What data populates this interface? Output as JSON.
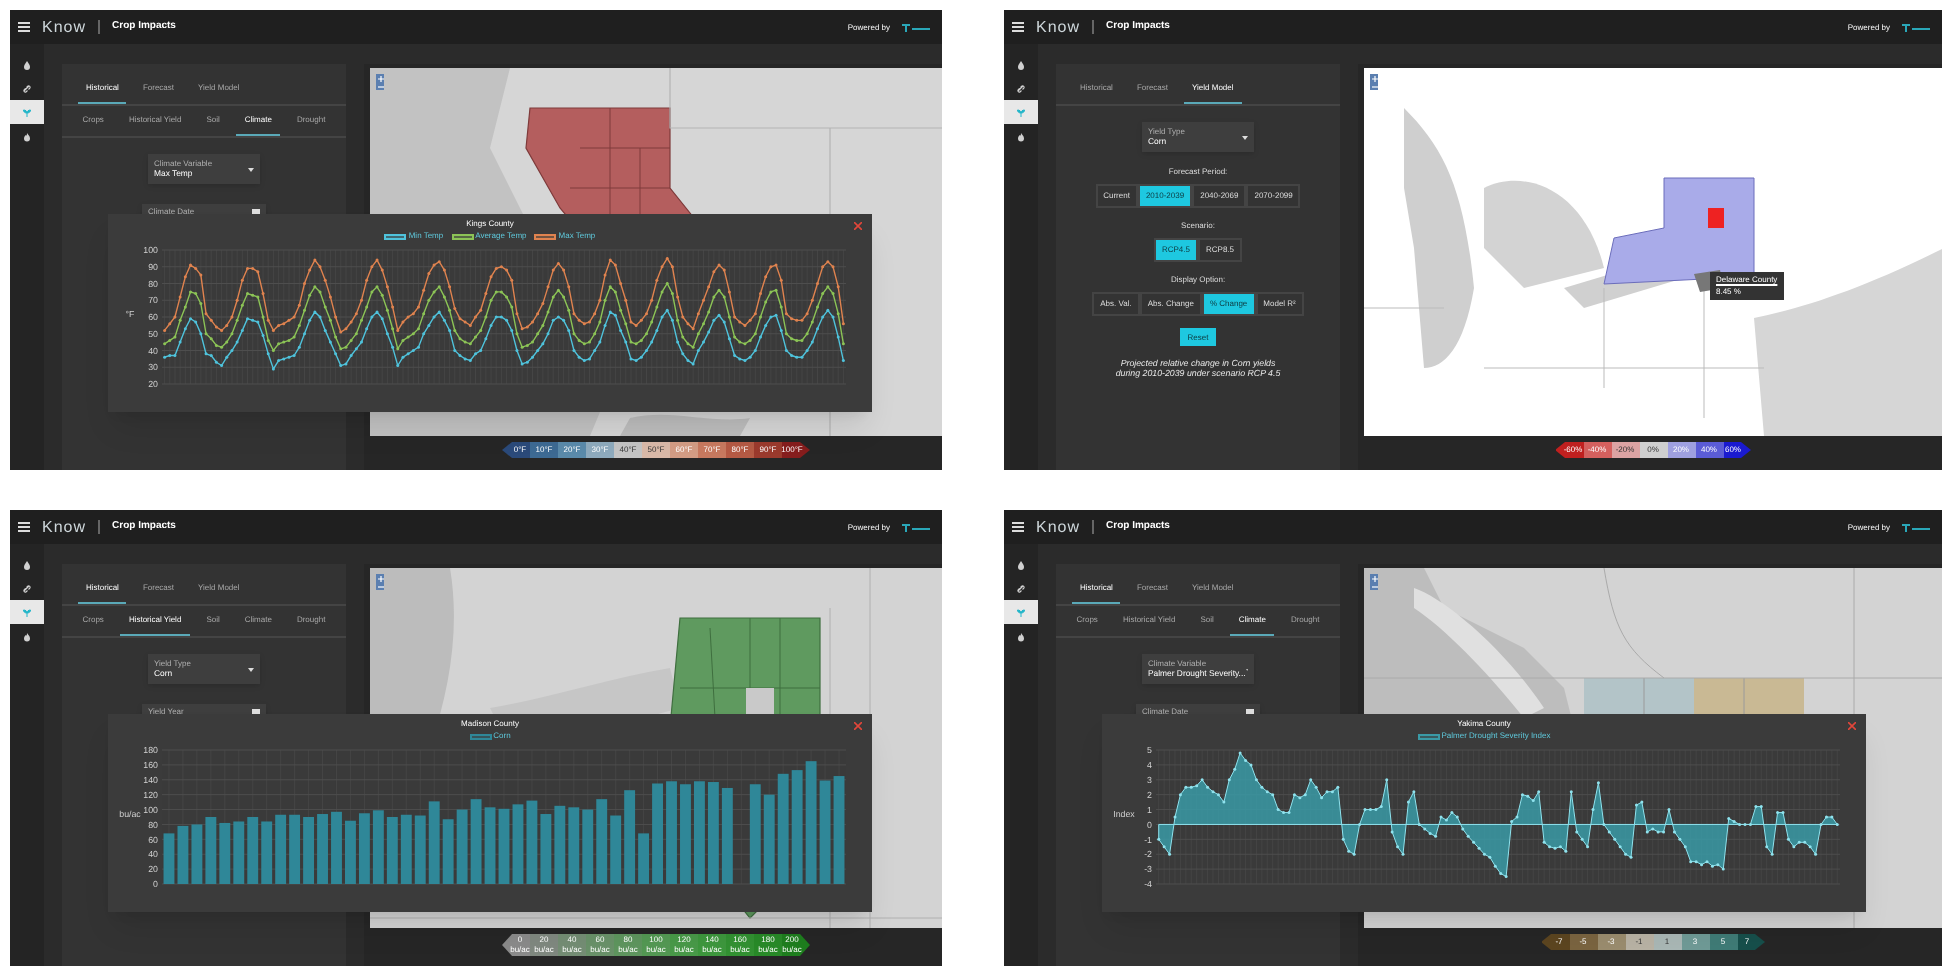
{
  "panels": [
    {
      "header": {
        "logo": "Know",
        "title": "Crop Impacts",
        "powered_by": "Powered by"
      },
      "rail": [
        {
          "kind": "drop",
          "selected": false
        },
        {
          "kind": "link",
          "selected": false
        },
        {
          "kind": "sprout",
          "selected": true
        },
        {
          "kind": "flame",
          "selected": false
        }
      ],
      "tabs": [
        {
          "label": "Historical",
          "selected": true
        },
        {
          "label": "Forecast",
          "selected": false
        },
        {
          "label": "Yield Model",
          "selected": false
        }
      ],
      "subtabs": [
        {
          "label": "Crops",
          "selected": false
        },
        {
          "label": "Historical Yield",
          "selected": false
        },
        {
          "label": "Soil",
          "selected": false
        },
        {
          "label": "Climate",
          "selected": true
        },
        {
          "label": "Drought",
          "selected": false
        }
      ],
      "fields": [
        {
          "kind": "select",
          "label": "Climate Variable",
          "value": "Max Temp"
        },
        {
          "kind": "date",
          "label": "Climate Date"
        }
      ],
      "map": {
        "kind": "picture"
      },
      "legend": [
        {
          "label": "0°F",
          "color": "#2b4a7a"
        },
        {
          "label": "10°F",
          "color": "#3d6a93"
        },
        {
          "label": "20°F",
          "color": "#5a8aaa"
        },
        {
          "label": "30°F",
          "color": "#8eaabd"
        },
        {
          "label": "40°F",
          "color": "#c4c4c4"
        },
        {
          "label": "50°F",
          "color": "#d9b9a8"
        },
        {
          "label": "60°F",
          "color": "#d39c84"
        },
        {
          "label": "70°F",
          "color": "#c7795f"
        },
        {
          "label": "80°F",
          "color": "#b55a44"
        },
        {
          "label": "90°F",
          "color": "#9b3a2d"
        },
        {
          "label": "100°F",
          "color": "#861d1d"
        }
      ],
      "modal": {
        "chart_data": {
          "type": "line",
          "title": "Kings County",
          "ylabel": "°F",
          "ylim": [
            20,
            100
          ],
          "grid": true,
          "yticks": [
            20,
            30,
            40,
            50,
            60,
            70,
            80,
            90,
            100
          ],
          "series": [
            {
              "name": "Min Temp",
              "color": "#4fc3dc",
              "values": [
                36,
                37,
                37,
                45,
                53,
                59,
                57,
                50,
                38,
                37,
                33,
                31,
                36,
                40,
                45,
                52,
                59,
                58,
                57,
                49,
                38,
                29,
                34,
                35,
                36,
                37,
                42,
                50,
                58,
                63,
                60,
                52,
                45,
                38,
                31,
                32,
                37,
                41,
                45,
                53,
                60,
                63,
                59,
                50,
                42,
                31,
                36,
                38,
                40,
                42,
                50,
                55,
                60,
                63,
                58,
                52,
                40,
                37,
                35,
                34,
                38,
                40,
                47,
                55,
                60,
                60,
                58,
                52,
                40,
                32,
                33,
                36,
                40,
                44,
                50,
                58,
                60,
                58,
                52,
                40,
                36,
                34,
                35,
                40,
                45,
                55,
                63,
                61,
                52,
                45,
                35,
                34,
                36,
                40,
                45,
                52,
                60,
                64,
                58,
                45,
                38,
                34,
                32,
                40,
                45,
                51,
                58,
                61,
                57,
                47,
                37,
                35,
                34,
                36,
                40,
                48,
                55,
                60,
                61,
                52,
                40,
                37,
                36,
                36,
                40,
                45,
                53,
                60,
                64,
                60,
                48,
                34
              ]
            },
            {
              "name": "Average Temp",
              "color": "#8cc456",
              "values": [
                44,
                46,
                48,
                58,
                66,
                75,
                74,
                68,
                50,
                47,
                43,
                42,
                45,
                50,
                58,
                67,
                74,
                73,
                72,
                60,
                46,
                40,
                44,
                45,
                46,
                48,
                55,
                64,
                73,
                78,
                75,
                66,
                58,
                48,
                41,
                42,
                46,
                50,
                58,
                66,
                75,
                78,
                73,
                64,
                53,
                41,
                46,
                48,
                50,
                53,
                62,
                70,
                75,
                78,
                72,
                64,
                52,
                47,
                45,
                44,
                48,
                52,
                60,
                70,
                75,
                75,
                72,
                66,
                50,
                42,
                43,
                45,
                50,
                55,
                63,
                72,
                76,
                72,
                64,
                50,
                46,
                44,
                45,
                50,
                57,
                70,
                78,
                75,
                64,
                56,
                45,
                44,
                46,
                50,
                57,
                66,
                75,
                80,
                74,
                58,
                48,
                44,
                42,
                50,
                56,
                63,
                72,
                76,
                72,
                60,
                48,
                45,
                44,
                46,
                50,
                60,
                69,
                75,
                76,
                66,
                50,
                47,
                46,
                46,
                50,
                57,
                66,
                74,
                78,
                74,
                62,
                44
              ]
            },
            {
              "name": "Max Temp",
              "color": "#e0834f",
              "values": [
                52,
                56,
                60,
                72,
                84,
                91,
                89,
                85,
                62,
                58,
                54,
                52,
                55,
                60,
                70,
                82,
                89,
                89,
                87,
                74,
                58,
                52,
                55,
                56,
                58,
                60,
                67,
                80,
                88,
                94,
                90,
                82,
                72,
                60,
                51,
                53,
                57,
                62,
                70,
                82,
                90,
                94,
                88,
                78,
                66,
                52,
                57,
                60,
                62,
                66,
                76,
                86,
                91,
                93,
                88,
                78,
                65,
                59,
                57,
                55,
                60,
                64,
                74,
                84,
                89,
                90,
                88,
                82,
                62,
                53,
                54,
                57,
                62,
                68,
                78,
                88,
                92,
                88,
                78,
                62,
                58,
                56,
                57,
                62,
                70,
                85,
                94,
                91,
                80,
                70,
                57,
                55,
                58,
                62,
                70,
                82,
                90,
                95,
                90,
                72,
                60,
                56,
                53,
                62,
                70,
                78,
                87,
                91,
                88,
                75,
                60,
                57,
                55,
                58,
                62,
                74,
                84,
                90,
                91,
                82,
                62,
                59,
                58,
                58,
                62,
                70,
                80,
                90,
                93,
                90,
                78,
                56
              ]
            }
          ]
        }
      }
    },
    {
      "header": {
        "logo": "Know",
        "title": "Crop Impacts",
        "powered_by": "Powered by"
      },
      "rail": [
        {
          "kind": "drop",
          "selected": false
        },
        {
          "kind": "link",
          "selected": false
        },
        {
          "kind": "sprout",
          "selected": true
        },
        {
          "kind": "flame",
          "selected": false
        }
      ],
      "tabs": [
        {
          "label": "Historical",
          "selected": false
        },
        {
          "label": "Forecast",
          "selected": false
        },
        {
          "label": "Yield Model",
          "selected": true
        }
      ],
      "fields": [
        {
          "kind": "select",
          "label": "Yield Type",
          "value": "Corn"
        }
      ],
      "button_groups": [
        {
          "label": "Forecast Period:",
          "options": [
            {
              "label": "Current",
              "selected": false
            },
            {
              "label": "2010-2039",
              "selected": true
            },
            {
              "label": "2040-2069",
              "selected": false
            },
            {
              "label": "2070-2099",
              "selected": false
            }
          ]
        },
        {
          "label": "Scenario:",
          "options": [
            {
              "label": "RCP4.5",
              "selected": true
            },
            {
              "label": "RCP8.5",
              "selected": false
            }
          ]
        },
        {
          "label": "Display Option:",
          "options": [
            {
              "label": "Abs. Val.",
              "selected": false
            },
            {
              "label": "Abs. Change",
              "selected": false
            },
            {
              "label": "% Change",
              "selected": true
            },
            {
              "label": "Model R²",
              "selected": false
            }
          ]
        }
      ],
      "reset": "Reset",
      "caption": "Projected relative change in Corn yields during 2010-2039 under scenario RCP 4.5",
      "map": {
        "kind": "picture",
        "tooltip": {
          "title": "Delaware County",
          "value": "8.45 %"
        }
      },
      "legend": [
        {
          "label": "-60%",
          "color": "#c0201f"
        },
        {
          "label": "-40%",
          "color": "#d4605e"
        },
        {
          "label": "-20%",
          "color": "#dca3a3"
        },
        {
          "label": "0%",
          "color": "#cfcfcf"
        },
        {
          "label": "20%",
          "color": "#9fa0e0"
        },
        {
          "label": "40%",
          "color": "#5b5cd6"
        },
        {
          "label": "60%",
          "color": "#1a1ad0"
        }
      ]
    },
    {
      "header": {
        "logo": "Know",
        "title": "Crop Impacts",
        "powered_by": "Powered by"
      },
      "rail": [
        {
          "kind": "drop",
          "selected": false
        },
        {
          "kind": "link",
          "selected": false
        },
        {
          "kind": "sprout",
          "selected": true
        },
        {
          "kind": "flame",
          "selected": false
        }
      ],
      "tabs": [
        {
          "label": "Historical",
          "selected": true
        },
        {
          "label": "Forecast",
          "selected": false
        },
        {
          "label": "Yield Model",
          "selected": false
        }
      ],
      "subtabs": [
        {
          "label": "Crops",
          "selected": false
        },
        {
          "label": "Historical Yield",
          "selected": true
        },
        {
          "label": "Soil",
          "selected": false
        },
        {
          "label": "Climate",
          "selected": false
        },
        {
          "label": "Drought",
          "selected": false
        }
      ],
      "fields": [
        {
          "kind": "select",
          "label": "Yield Type",
          "value": "Corn"
        },
        {
          "kind": "date",
          "label": "Yield Year"
        }
      ],
      "map": {
        "kind": "picture"
      },
      "legend": [
        {
          "label": "0",
          "unit": "bu/ac",
          "color": "#8a8a8a"
        },
        {
          "label": "20",
          "unit": "bu/ac",
          "color": "#7f887f"
        },
        {
          "label": "40",
          "unit": "bu/ac",
          "color": "#748d74"
        },
        {
          "label": "60",
          "unit": "bu/ac",
          "color": "#699169"
        },
        {
          "label": "80",
          "unit": "bu/ac",
          "color": "#5e955e"
        },
        {
          "label": "100",
          "unit": "bu/ac",
          "color": "#539853"
        },
        {
          "label": "120",
          "unit": "bu/ac",
          "color": "#489948"
        },
        {
          "label": "140",
          "unit": "bu/ac",
          "color": "#3d973d"
        },
        {
          "label": "160",
          "unit": "bu/ac",
          "color": "#329132"
        },
        {
          "label": "180",
          "unit": "bu/ac",
          "color": "#288a28"
        },
        {
          "label": "200",
          "unit": "bu/ac",
          "color": "#1e7e1e"
        }
      ],
      "modal": {
        "chart_data": {
          "type": "bar",
          "title": "Madison County",
          "ylabel": "bu/ac",
          "ylim": [
            0,
            180
          ],
          "grid": true,
          "yticks": [
            0,
            20,
            40,
            60,
            80,
            100,
            120,
            140,
            160,
            180
          ],
          "series": [
            {
              "name": "Corn",
              "color": "#2f8798",
              "values": [
                68,
                78,
                80,
                90,
                82,
                84,
                90,
                84,
                93,
                93,
                90,
                94,
                97,
                85,
                95,
                99,
                90,
                93,
                92,
                111,
                87,
                100,
                114,
                103,
                101,
                107,
                112,
                94,
                105,
                103,
                100,
                114,
                92,
                126,
                68,
                135,
                138,
                134,
                138,
                137,
                129,
                null,
                134,
                120,
                148,
                153,
                165,
                139,
                145
              ]
            }
          ]
        }
      }
    },
    {
      "header": {
        "logo": "Know",
        "title": "Crop Impacts",
        "powered_by": "Powered by"
      },
      "rail": [
        {
          "kind": "drop",
          "selected": false
        },
        {
          "kind": "link",
          "selected": false
        },
        {
          "kind": "sprout",
          "selected": true
        },
        {
          "kind": "flame",
          "selected": false
        }
      ],
      "tabs": [
        {
          "label": "Historical",
          "selected": true
        },
        {
          "label": "Forecast",
          "selected": false
        },
        {
          "label": "Yield Model",
          "selected": false
        }
      ],
      "subtabs": [
        {
          "label": "Crops",
          "selected": false
        },
        {
          "label": "Historical Yield",
          "selected": false
        },
        {
          "label": "Soil",
          "selected": false
        },
        {
          "label": "Climate",
          "selected": true
        },
        {
          "label": "Drought",
          "selected": false
        }
      ],
      "fields": [
        {
          "kind": "select",
          "label": "Climate Variable",
          "value": "Palmer Drought Severity..."
        },
        {
          "kind": "date",
          "label": "Climate Date"
        }
      ],
      "map": {
        "kind": "picture"
      },
      "legend": [
        {
          "label": "-7",
          "color": "#5c4520"
        },
        {
          "label": "-5",
          "color": "#7a6440"
        },
        {
          "label": "-3",
          "color": "#9a8c6e"
        },
        {
          "label": "-1",
          "color": "#b8b2a4"
        },
        {
          "label": "1",
          "color": "#a9b7b5"
        },
        {
          "label": "3",
          "color": "#6f9a96"
        },
        {
          "label": "5",
          "color": "#3f7b76"
        },
        {
          "label": "7",
          "color": "#174f4b"
        }
      ],
      "modal": {
        "chart_data": {
          "type": "area",
          "title": "Yakima County",
          "ylabel": "Index",
          "ylim": [
            -4,
            5
          ],
          "grid": true,
          "yticks": [
            -4,
            -3,
            -2,
            -1,
            0,
            1,
            2,
            3,
            4,
            5
          ],
          "series": [
            {
              "name": "Palmer Drought Severity Index",
              "color": "#3a9aa6",
              "values": [
                -1,
                -1.5,
                -2,
                0.5,
                2,
                2.5,
                2.5,
                2.6,
                3,
                2.5,
                2.2,
                2,
                1.5,
                3,
                3.7,
                4.8,
                4.3,
                4,
                3,
                2.5,
                2.2,
                2,
                1,
                0.8,
                0.8,
                2,
                1.8,
                2,
                3,
                2.5,
                1.8,
                2.2,
                2.2,
                2.5,
                -1,
                -1.8,
                -2,
                0,
                1,
                1,
                1,
                1.2,
                3,
                -0.5,
                -1.5,
                -2,
                1.5,
                2.2,
                0,
                -0.3,
                -0.6,
                -0.8,
                0.5,
                0.3,
                0.8,
                0.5,
                -0.3,
                -0.8,
                -1.2,
                -1.6,
                -2,
                -2.2,
                -2.8,
                -3.3,
                -3.5,
                0.2,
                0.5,
                2,
                1.9,
                1.6,
                2.2,
                -1.2,
                -1.5,
                -1.6,
                -1.5,
                -1.8,
                2.2,
                -0.5,
                -1,
                -1.5,
                1,
                2.8,
                0,
                -0.5,
                -1,
                -1.5,
                -2,
                -2.2,
                1.3,
                1.5,
                -0.5,
                -0.3,
                -0.5,
                -0.5,
                1,
                -0.5,
                -1,
                -1.5,
                -2.5,
                -2.5,
                -2.7,
                -2.5,
                -2.8,
                -2.7,
                -3,
                0.4,
                0.2,
                0,
                0,
                0,
                1.2,
                1.2,
                -1.5,
                -2,
                0.8,
                0.8,
                -1,
                -1.5,
                -1.2,
                -1.2,
                -1.5,
                -2,
                0,
                0.5,
                0.5,
                0
              ]
            }
          ]
        }
      }
    }
  ]
}
